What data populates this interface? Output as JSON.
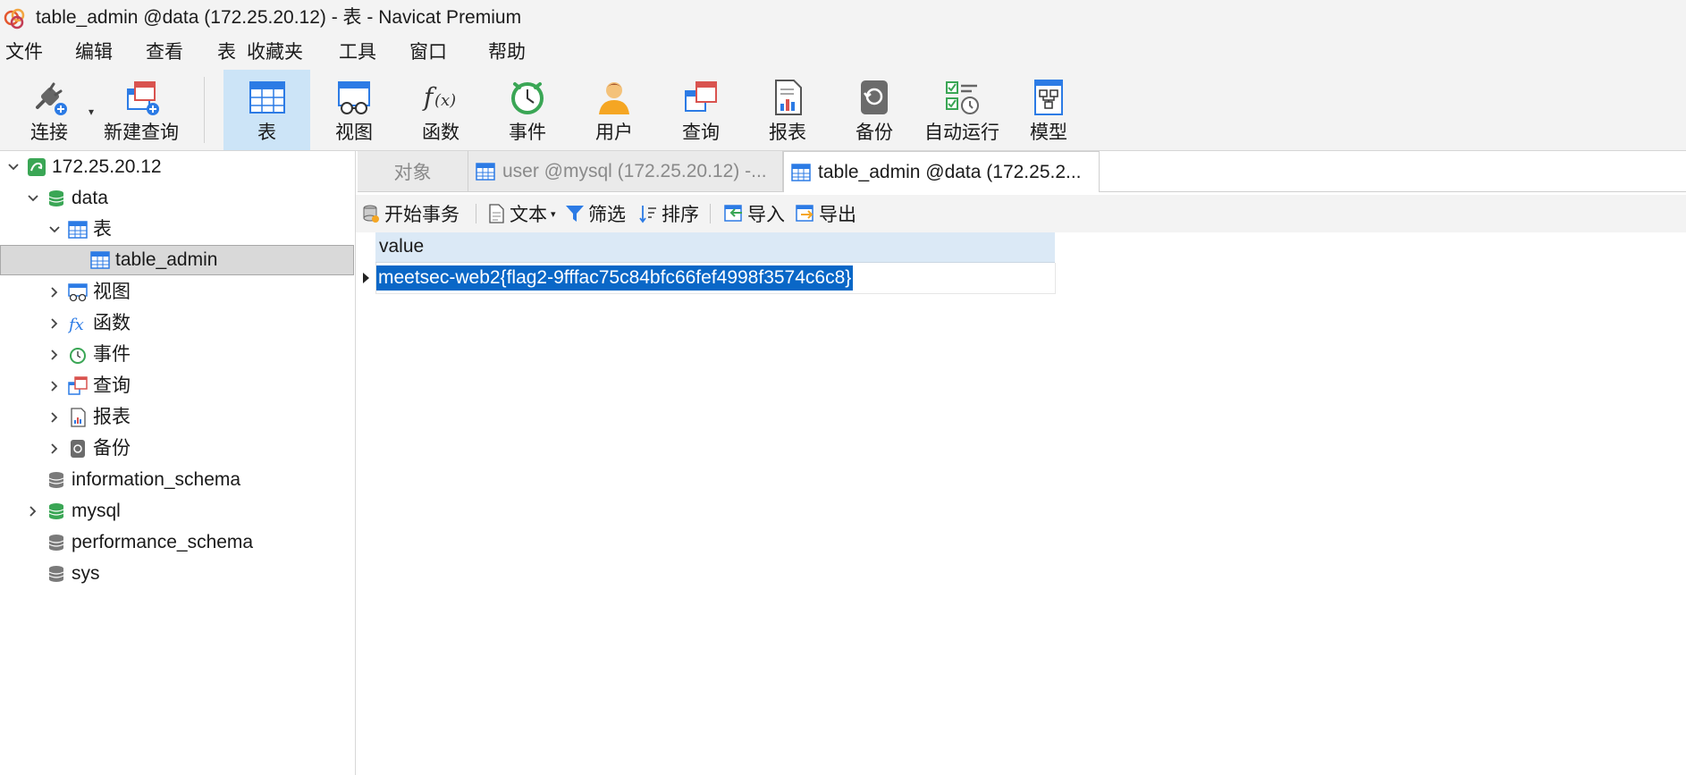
{
  "window": {
    "title": "table_admin @data (172.25.20.12) - 表 - Navicat Premium"
  },
  "menu": [
    "文件",
    "编辑",
    "查看",
    "表",
    "收藏夹",
    "工具",
    "窗口",
    "帮助"
  ],
  "toolbar": {
    "connect": "连接",
    "new_query": "新建查询",
    "table": "表",
    "view": "视图",
    "function": "函数",
    "event": "事件",
    "user": "用户",
    "query": "查询",
    "report": "报表",
    "backup": "备份",
    "automation": "自动运行",
    "model": "模型"
  },
  "tree": {
    "connection": "172.25.20.12",
    "db_data": "data",
    "tables_group": "表",
    "table_admin": "table_admin",
    "views": "视图",
    "functions": "函数",
    "events": "事件",
    "queries": "查询",
    "reports": "报表",
    "backups": "备份",
    "db_information_schema": "information_schema",
    "db_mysql": "mysql",
    "db_performance_schema": "performance_schema",
    "db_sys": "sys"
  },
  "tabs": {
    "objects": "对象",
    "user_tab": "user @mysql (172.25.20.12) -...",
    "table_admin_tab": "table_admin @data (172.25.2..."
  },
  "subtoolbar": {
    "begin_transaction": "开始事务",
    "text": "文本",
    "filter": "筛选",
    "sort": "排序",
    "import": "导入",
    "export": "导出"
  },
  "grid": {
    "columns": [
      "value"
    ],
    "rows": [
      [
        "meetsec-web2{flag2-9fffac75c84bfc66fef4998f3574c6c8}"
      ]
    ]
  },
  "colors": {
    "selection": "#0a67c7",
    "active_tool": "#cce4f7",
    "header": "#dbe9f6"
  }
}
